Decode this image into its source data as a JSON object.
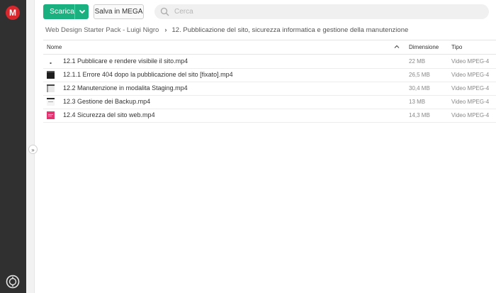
{
  "sidebar": {
    "logo_letter": "M",
    "logo_icon": "mega-logo-icon",
    "sync_icon": "transfer-sync-icon",
    "expand_toggle": "»"
  },
  "toolbar": {
    "download_label": "Scarica",
    "save_label": "Salva in MEGA"
  },
  "search": {
    "placeholder": "Cerca",
    "value": ""
  },
  "breadcrumb": {
    "root": "Web Design Starter Pack - Luigi Nigro",
    "current": "12. Pubblicazione del sito, sicurezza informatica e gestione della manutenzione"
  },
  "table": {
    "headers": {
      "name": "Nome",
      "size": "Dimensione",
      "type": "Tipo"
    },
    "rows": [
      {
        "name": "12.1 Pubblicare e rendere visibile il sito.mp4",
        "size": "22 MB",
        "type": "Video MPEG-4",
        "thumb": "white"
      },
      {
        "name": "12.1.1 Errore 404 dopo la pubblicazione del sito [fixato].mp4",
        "size": "26,5 MB",
        "type": "Video MPEG-4",
        "thumb": "dark"
      },
      {
        "name": "12.2 Manutenzione in modalita Staging.mp4",
        "size": "30,4 MB",
        "type": "Video MPEG-4",
        "thumb": "gray"
      },
      {
        "name": "12.3 Gestione dei Backup.mp4",
        "size": "13 MB",
        "type": "Video MPEG-4",
        "thumb": "light"
      },
      {
        "name": "12.4 Sicurezza del sito web.mp4",
        "size": "14,3 MB",
        "type": "Video MPEG-4",
        "thumb": "pink"
      }
    ]
  },
  "colors": {
    "accent": "#1ab080",
    "brand": "#d9272e",
    "rail": "#303030"
  }
}
